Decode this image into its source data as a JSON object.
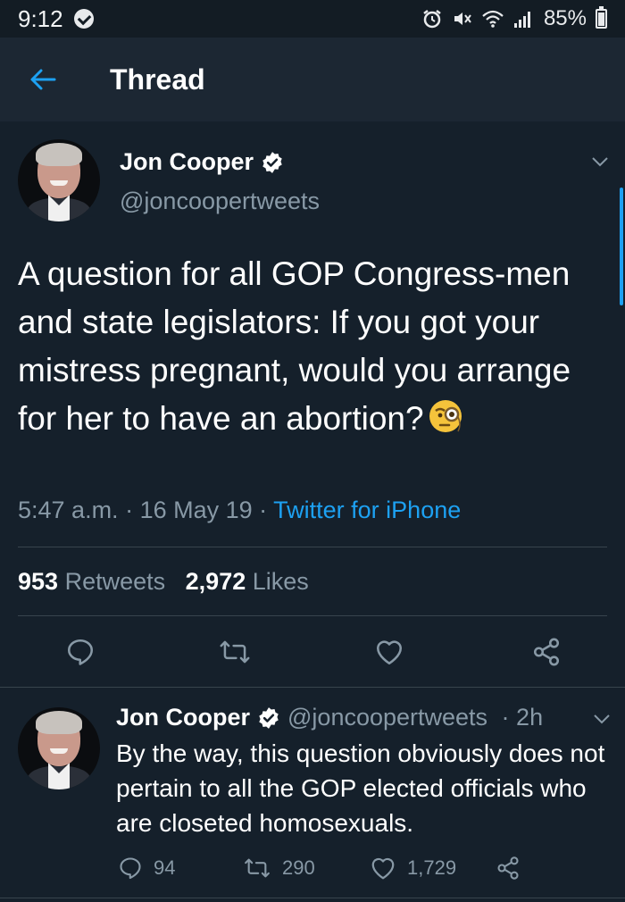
{
  "status_bar": {
    "time": "9:12",
    "battery": "85%",
    "battery_level": 0.85
  },
  "header": {
    "title": "Thread"
  },
  "tweet": {
    "author_name": "Jon Cooper",
    "handle": "@joncoopertweets",
    "text": "A question for all GOP Congress-men and state legislators: If you got your mistress pregnant, would you arrange for her to have an abortion?",
    "time": "5:47 a.m.",
    "date": "16 May 19",
    "source": "Twitter for iPhone",
    "retweets_count": "953",
    "retweets_label": "Retweets",
    "likes_count": "2,972",
    "likes_label": "Likes"
  },
  "reply": {
    "author_name": "Jon Cooper",
    "handle": "@joncoopertweets",
    "age": "2h",
    "text": "By the way, this question obviously does not pertain to all the GOP elected officials who are closeted homosexuals.",
    "replies": "94",
    "retweets": "290",
    "likes": "1,729"
  },
  "colors": {
    "background": "#15202b",
    "header": "#1c2733",
    "accent": "#1da1f2",
    "secondary_text": "#8899a6"
  }
}
